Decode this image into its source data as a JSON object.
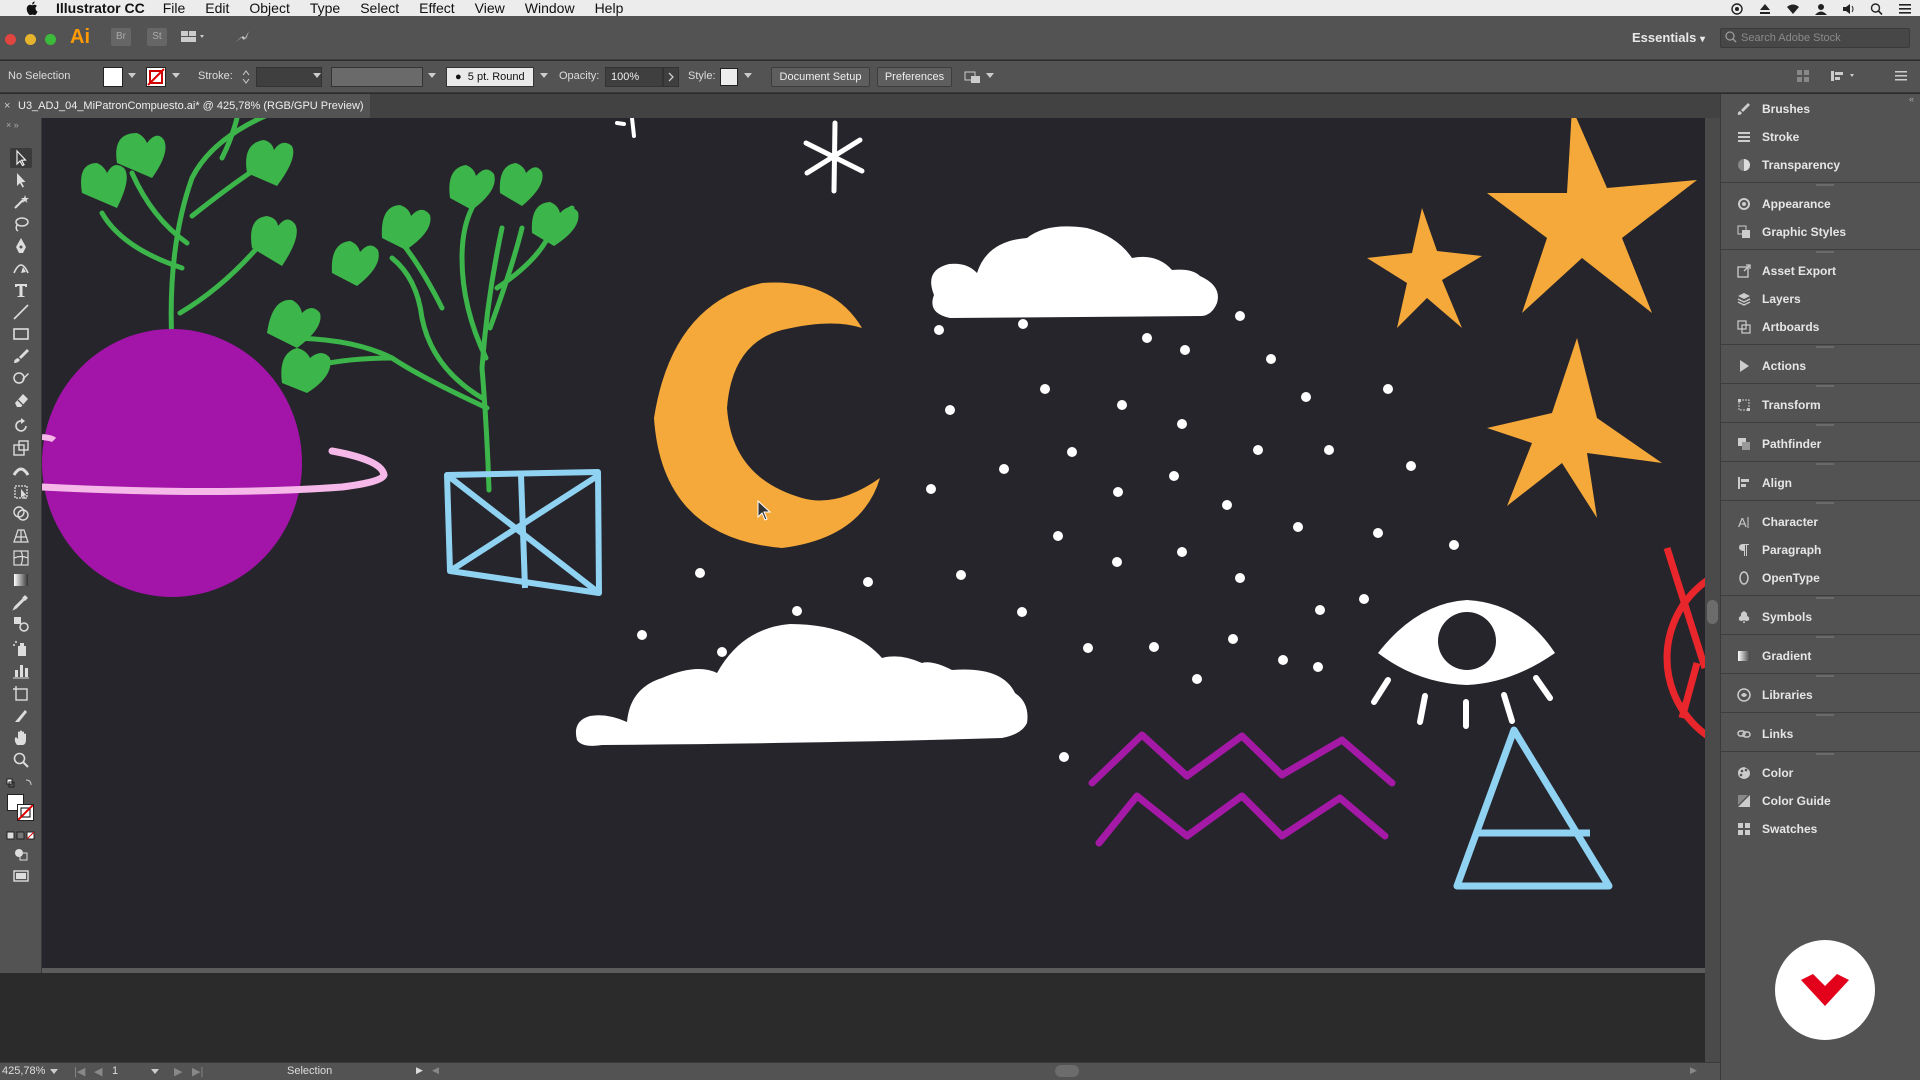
{
  "menubar": {
    "app_name": "Illustrator CC",
    "items": [
      "File",
      "Edit",
      "Object",
      "Type",
      "Select",
      "Effect",
      "View",
      "Window",
      "Help"
    ]
  },
  "appbar": {
    "logo": "Ai",
    "stock_icon": "St",
    "workspace": "Essentials",
    "search_placeholder": "Search Adobe Stock"
  },
  "controlbar": {
    "selection": "No Selection",
    "stroke_label": "Stroke:",
    "brush": "5 pt. Round",
    "opacity_label": "Opacity:",
    "opacity_value": "100%",
    "style_label": "Style:",
    "doc_setup": "Document Setup",
    "preferences": "Preferences"
  },
  "document": {
    "tab_title": "U3_ADJ_04_MiPatronCompuesto.ai* @ 425,78% (RGB/GPU Preview)"
  },
  "panels": [
    {
      "label": "Brushes",
      "icon": "brushes-icon"
    },
    {
      "label": "Stroke",
      "icon": "stroke-icon"
    },
    {
      "label": "Transparency",
      "icon": "transparency-icon"
    },
    {
      "label": "Appearance",
      "icon": "appearance-icon"
    },
    {
      "label": "Graphic Styles",
      "icon": "graphic-styles-icon"
    },
    {
      "label": "Asset Export",
      "icon": "asset-export-icon"
    },
    {
      "label": "Layers",
      "icon": "layers-icon"
    },
    {
      "label": "Artboards",
      "icon": "artboards-icon"
    },
    {
      "label": "Actions",
      "icon": "actions-icon"
    },
    {
      "label": "Transform",
      "icon": "transform-icon"
    },
    {
      "label": "Pathfinder",
      "icon": "pathfinder-icon"
    },
    {
      "label": "Align",
      "icon": "align-icon"
    },
    {
      "label": "Character",
      "icon": "character-icon"
    },
    {
      "label": "Paragraph",
      "icon": "paragraph-icon"
    },
    {
      "label": "OpenType",
      "icon": "opentype-icon"
    },
    {
      "label": "Symbols",
      "icon": "symbols-icon"
    },
    {
      "label": "Gradient",
      "icon": "gradient-icon"
    },
    {
      "label": "Libraries",
      "icon": "libraries-icon"
    },
    {
      "label": "Links",
      "icon": "links-icon"
    },
    {
      "label": "Color",
      "icon": "color-icon"
    },
    {
      "label": "Color Guide",
      "icon": "color-guide-icon"
    },
    {
      "label": "Swatches",
      "icon": "swatches-icon"
    }
  ],
  "statusbar": {
    "zoom": "425,78%",
    "artboard_number": "1",
    "tool_name": "Selection"
  },
  "colors": {
    "artboard_bg": "#26252b",
    "green": "#3cb54a",
    "orange": "#f5a93a",
    "purple": "#a314a8",
    "pink": "#f5b8e8",
    "light_blue": "#8fd2f2",
    "magenta_zigzag": "#a41aa6",
    "red": "#e8262b",
    "white": "#ffffff"
  }
}
